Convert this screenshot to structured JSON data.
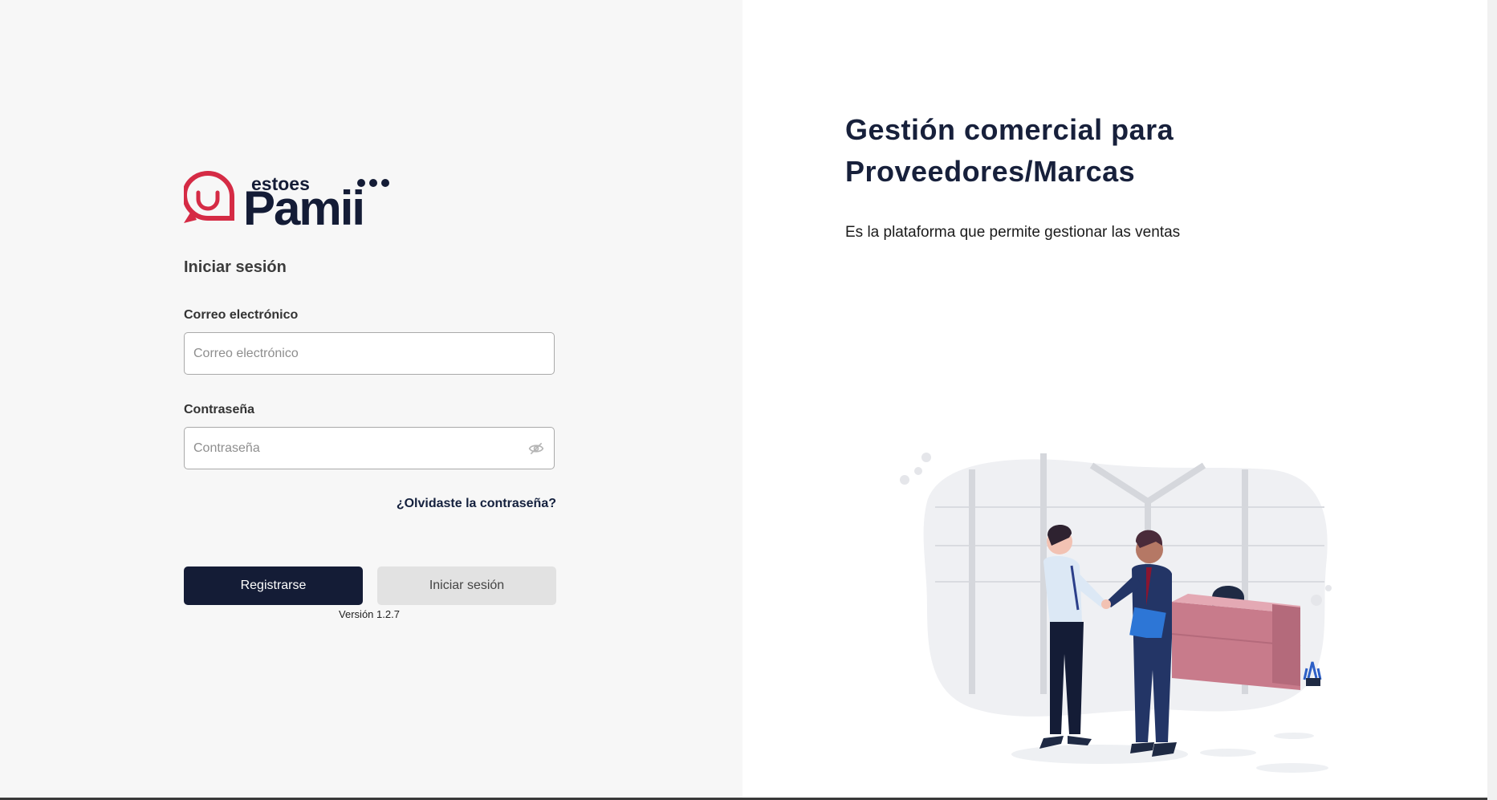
{
  "brand": {
    "logo_small_text": "estoes",
    "logo_main_text": "Pamii",
    "primary_color": "#141c36",
    "accent_color": "#d52b45"
  },
  "login": {
    "heading": "Iniciar sesión",
    "email": {
      "label": "Correo electrónico",
      "placeholder": "Correo electrónico",
      "value": ""
    },
    "password": {
      "label": "Contraseña",
      "placeholder": "Contraseña",
      "value": "",
      "toggle_icon": "eye-off-icon"
    },
    "forgot_link": "¿Olvidaste la contraseña?",
    "register_button": "Registrarse",
    "login_button": "Iniciar sesión",
    "version": "Versión 1.2.7"
  },
  "hero": {
    "title_line1": "Gestión comercial para",
    "title_line2": "Proveedores/Marcas",
    "subtitle": "Es la plataforma que permite gestionar las ventas",
    "illustration": "business-handshake-illustration"
  }
}
